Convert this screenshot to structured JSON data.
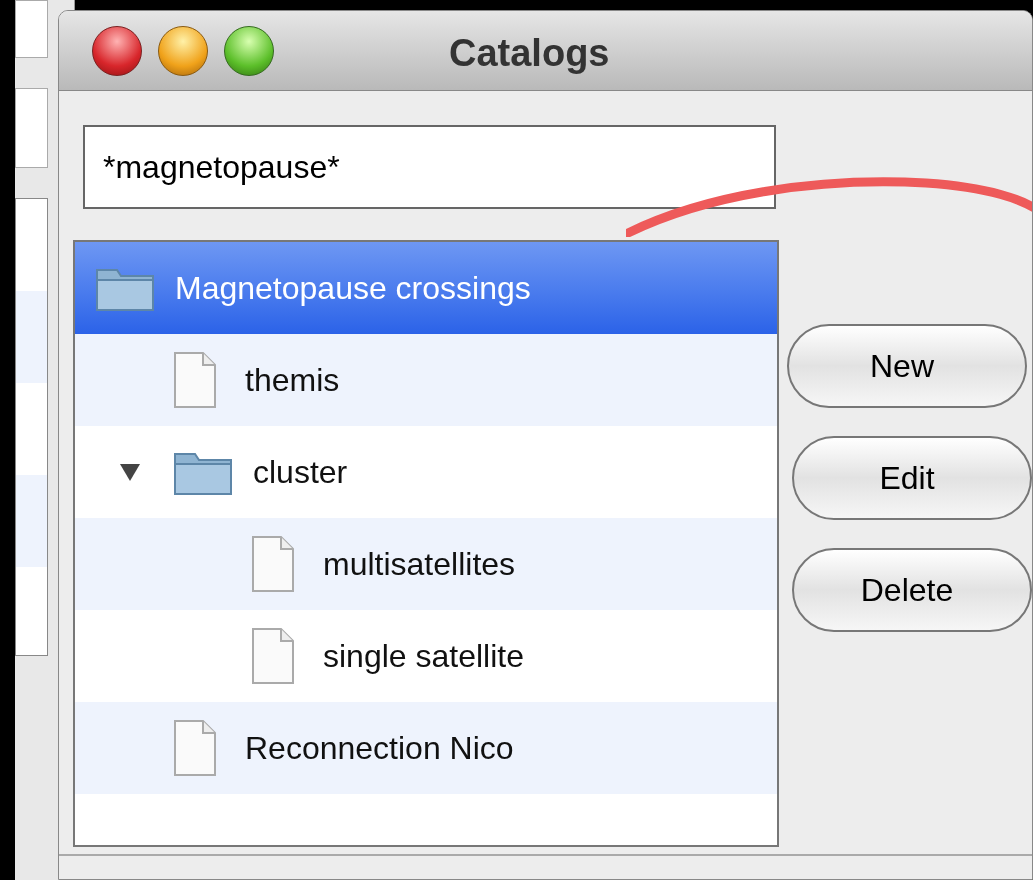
{
  "window": {
    "title": "Catalogs"
  },
  "search": {
    "value": "*magnetopause*"
  },
  "tree": [
    {
      "label": "Magnetopause crossings",
      "kind": "folder",
      "selected": true,
      "children": [
        {
          "label": "themis",
          "kind": "file",
          "selected": false
        },
        {
          "label": "cluster",
          "kind": "folder",
          "selected": false,
          "expanded": true,
          "children": [
            {
              "label": "multisatellites",
              "kind": "file",
              "selected": false
            },
            {
              "label": "single satellite",
              "kind": "file",
              "selected": false
            }
          ]
        },
        {
          "label": "Reconnection Nico",
          "kind": "file",
          "selected": false
        }
      ]
    }
  ],
  "buttons": [
    "New",
    "Edit",
    "Delete"
  ]
}
